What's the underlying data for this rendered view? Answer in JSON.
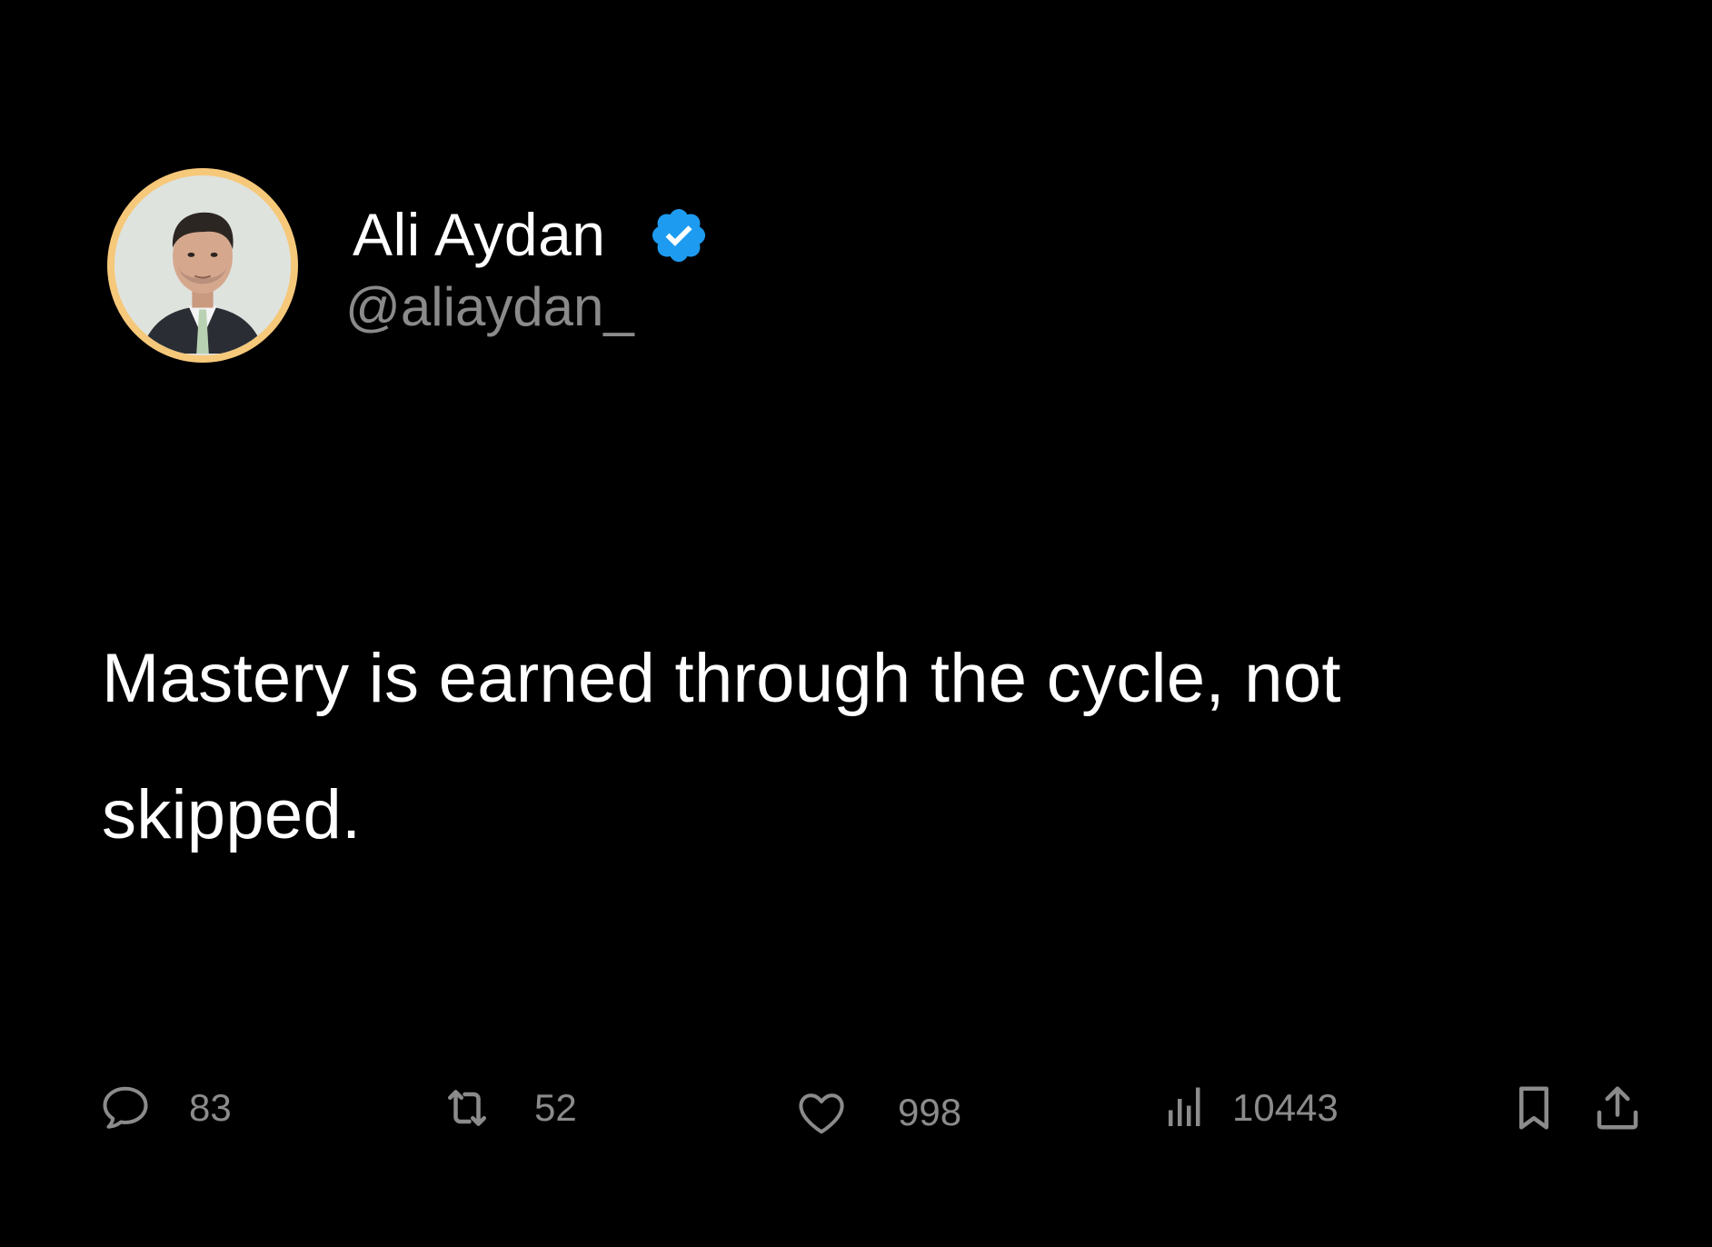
{
  "author": {
    "display_name": "Ali Aydan",
    "handle": "@aliaydan_",
    "verified": true,
    "verified_color": "#1d9bf0",
    "avatar_ring_color": "#f6c87a"
  },
  "tweet": {
    "text": "Mastery is earned through the cycle, not skipped."
  },
  "actions": {
    "reply": {
      "icon": "reply-icon",
      "count": "83"
    },
    "retweet": {
      "icon": "retweet-icon",
      "count": "52"
    },
    "like": {
      "icon": "heart-icon",
      "count": "998"
    },
    "views": {
      "icon": "views-icon",
      "count": "10443"
    },
    "bookmark": {
      "icon": "bookmark-icon"
    },
    "share": {
      "icon": "share-icon"
    }
  },
  "colors": {
    "background": "#000000",
    "text": "#ffffff",
    "muted": "#8b8b8b"
  }
}
